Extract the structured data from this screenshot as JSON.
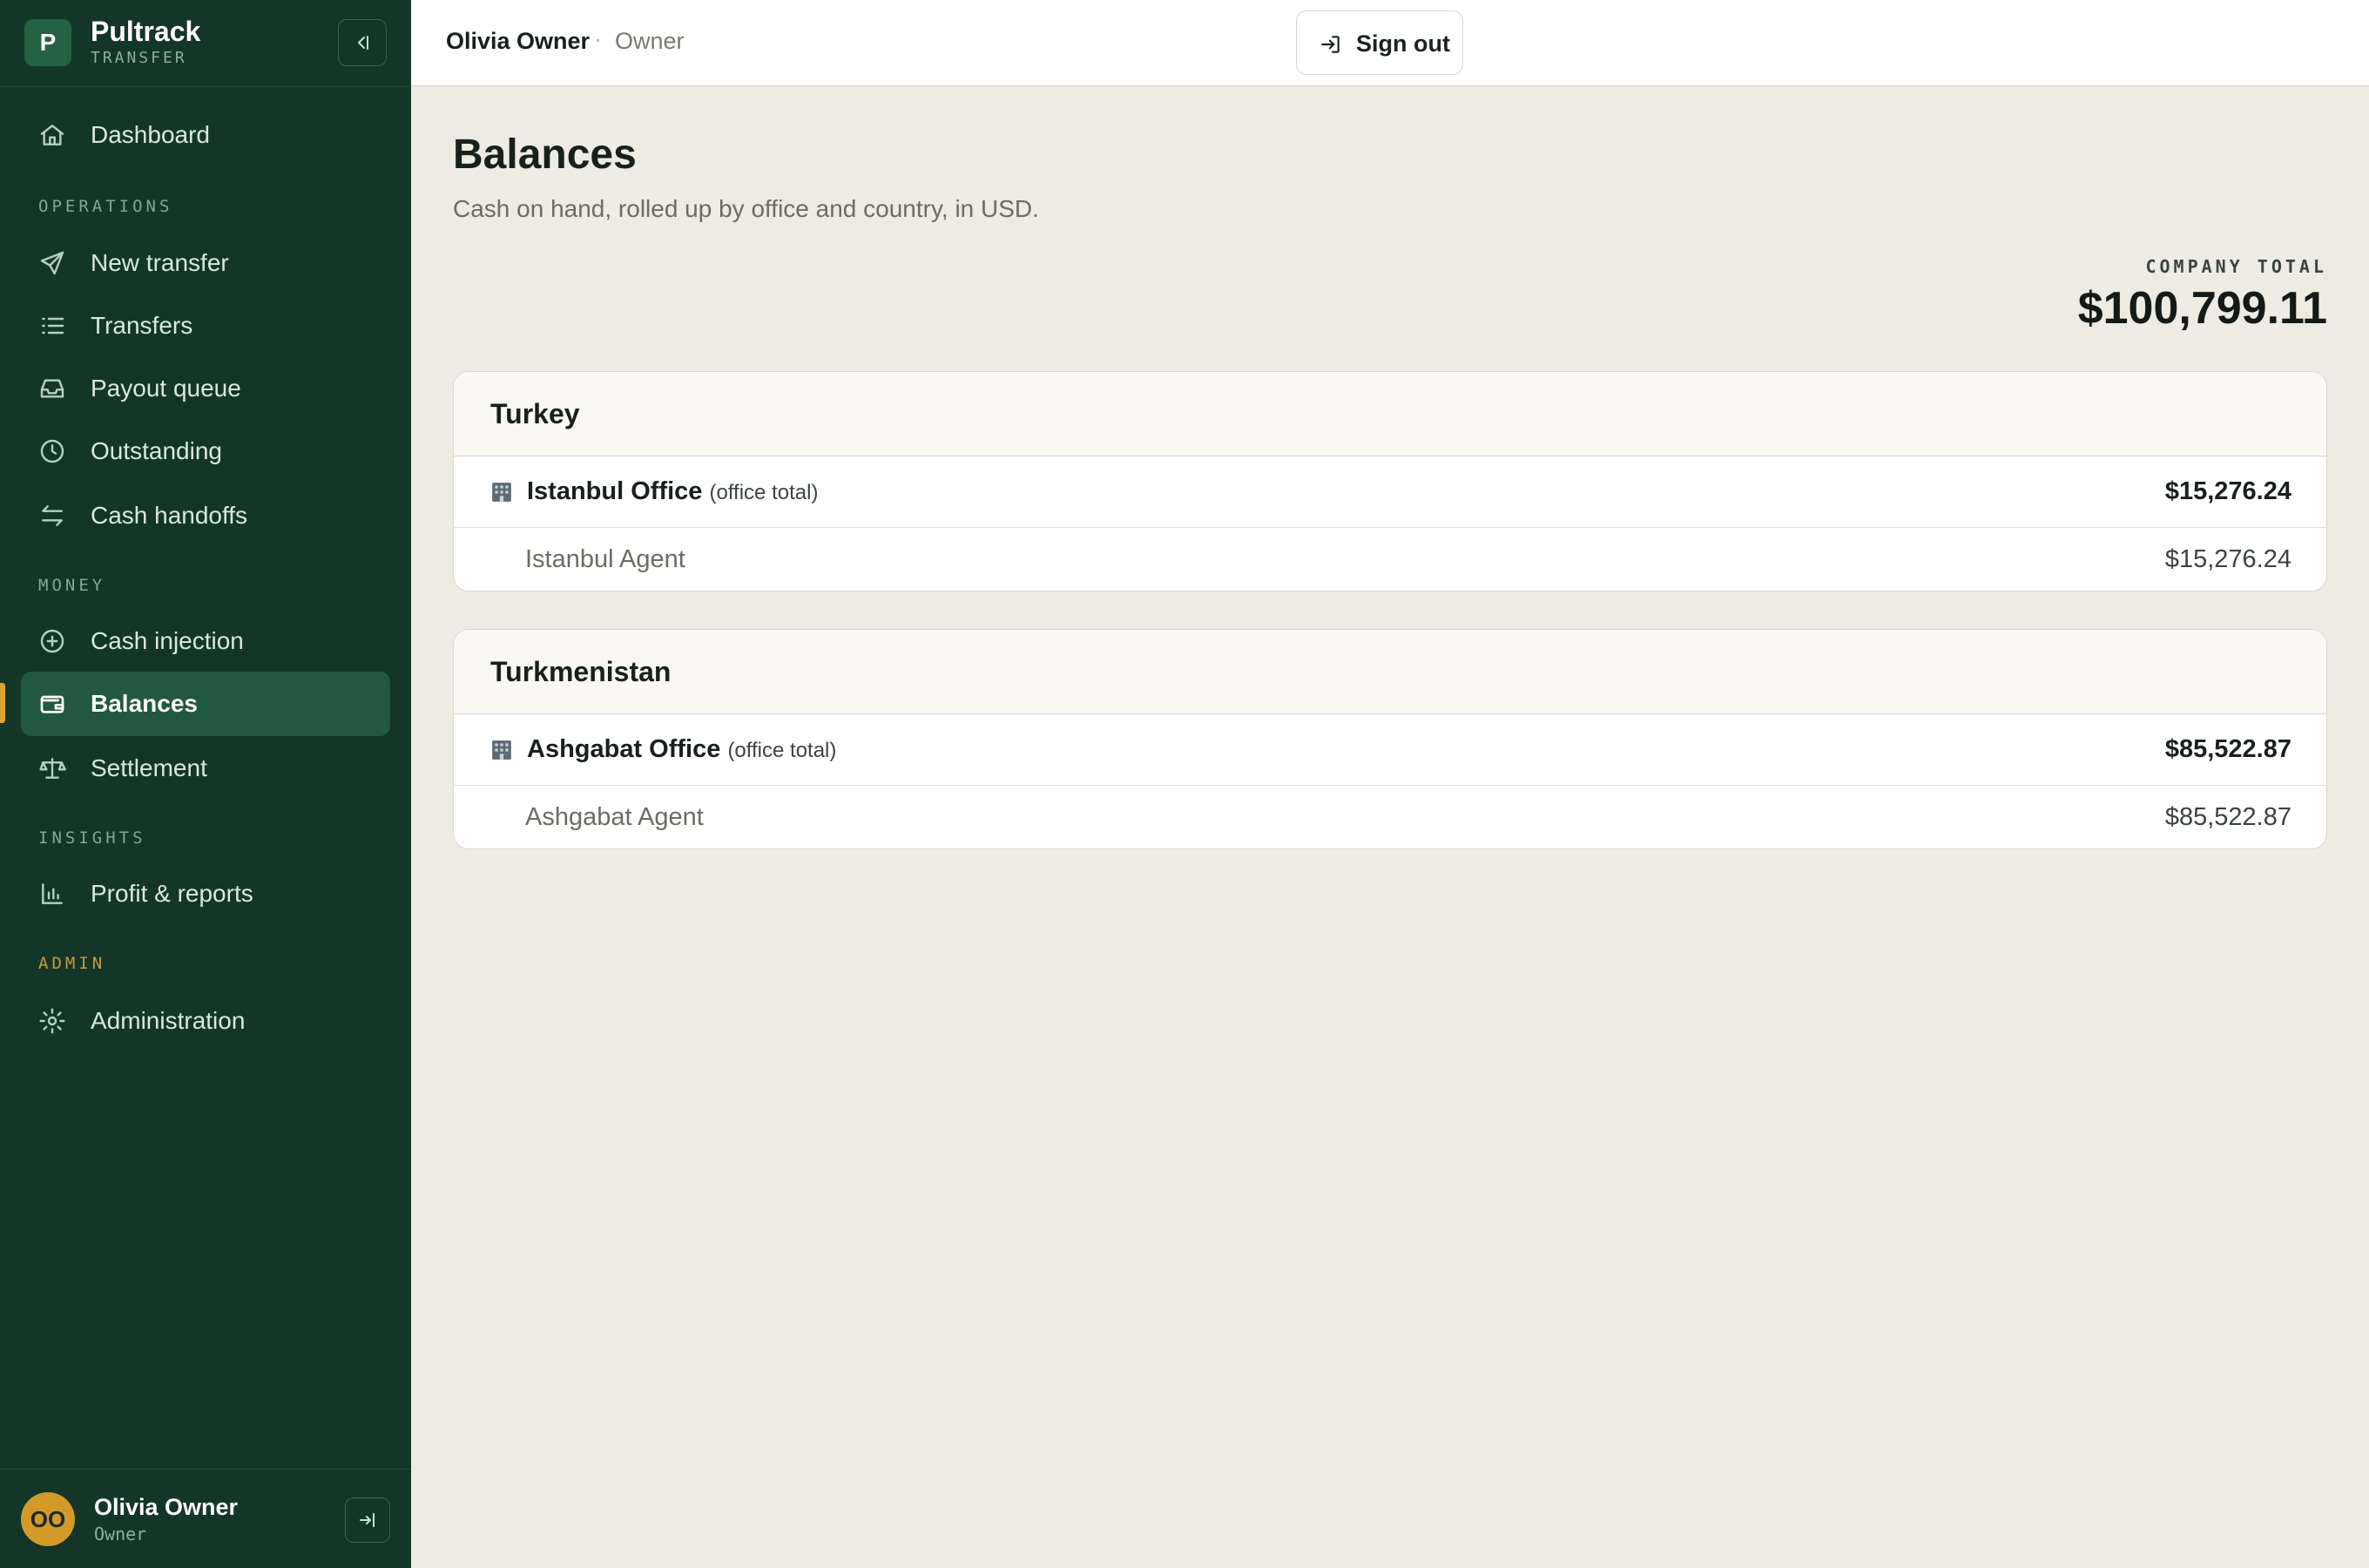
{
  "brand": {
    "logo_letter": "P",
    "name": "Pultrack",
    "subtitle": "TRANSFER"
  },
  "sidebar": {
    "dashboard": "Dashboard",
    "sections": {
      "operations": "OPERATIONS",
      "money": "MONEY",
      "insights": "INSIGHTS",
      "admin": "ADMIN"
    },
    "items": {
      "new_transfer": "New transfer",
      "transfers": "Transfers",
      "payout_queue": "Payout queue",
      "outstanding": "Outstanding",
      "cash_handoffs": "Cash handoffs",
      "cash_injection": "Cash injection",
      "balances": "Balances",
      "settlement": "Settlement",
      "profit_reports": "Profit & reports",
      "administration": "Administration"
    },
    "active_item": "balances"
  },
  "user": {
    "initials": "OO",
    "name": "Olivia Owner",
    "role": "Owner"
  },
  "topbar": {
    "user_name": "Olivia Owner",
    "separator": "·",
    "role": "Owner",
    "sign_out": "Sign out"
  },
  "page": {
    "title": "Balances",
    "subtitle": "Cash on hand, rolled up by office and country, in USD.",
    "company_total_label": "COMPANY TOTAL",
    "company_total": "$100,799.11"
  },
  "countries": [
    {
      "name": "Turkey",
      "office": {
        "name": "Istanbul Office",
        "suffix": "(office total)",
        "amount": "$15,276.24"
      },
      "agent": {
        "name": "Istanbul Agent",
        "amount": "$15,276.24"
      }
    },
    {
      "name": "Turkmenistan",
      "office": {
        "name": "Ashgabat Office",
        "suffix": "(office total)",
        "amount": "$85,522.87"
      },
      "agent": {
        "name": "Ashgabat Agent",
        "amount": "$85,522.87"
      }
    }
  ],
  "colors": {
    "sidebar_bg": "#133628",
    "active_bg": "#22583f",
    "accent": "#d9a432",
    "page_bg": "#eeebe3"
  }
}
